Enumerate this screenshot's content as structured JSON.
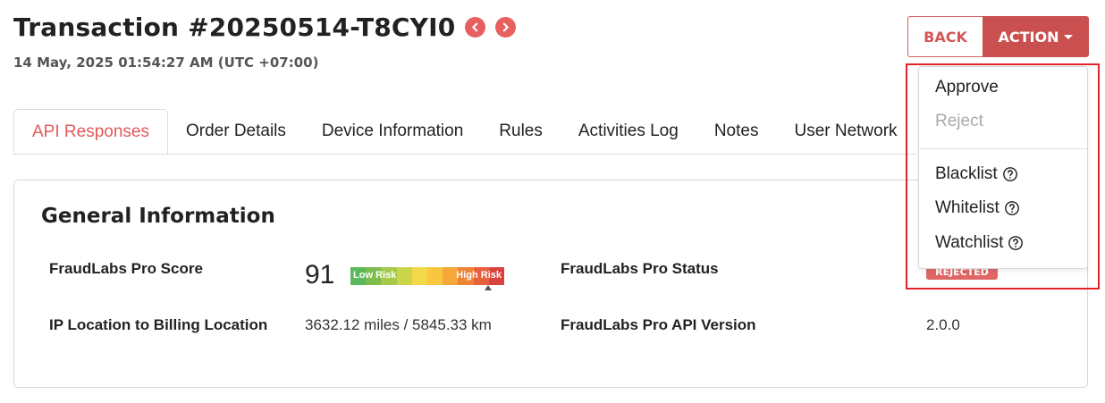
{
  "header": {
    "title": "Transaction #20250514-T8CYI0",
    "timestamp": "14 May, 2025 01:54:27 AM (UTC +07:00)",
    "prev_icon": "chevron-left-icon",
    "next_icon": "chevron-right-icon"
  },
  "toolbar": {
    "back_label": "BACK",
    "action_label": "ACTION"
  },
  "tabs": [
    {
      "label": "API Responses",
      "active": true
    },
    {
      "label": "Order Details",
      "active": false
    },
    {
      "label": "Device Information",
      "active": false
    },
    {
      "label": "Rules",
      "active": false
    },
    {
      "label": "Activities Log",
      "active": false
    },
    {
      "label": "Notes",
      "active": false
    },
    {
      "label": "User Network",
      "active": false
    }
  ],
  "general": {
    "title": "General Information",
    "score_label": "FraudLabs Pro Score",
    "score_value": "91",
    "risk_low_label": "Low Risk",
    "risk_high_label": "High Risk",
    "status_label": "FraudLabs Pro Status",
    "status_value": "REJECTED",
    "ip_label": "IP Location to Billing Location",
    "ip_value": "3632.12 miles / 5845.33 km",
    "api_version_label": "FraudLabs Pro API Version",
    "api_version_value": "2.0.0"
  },
  "action_menu": {
    "items": [
      {
        "label": "Approve",
        "disabled": false
      },
      {
        "label": "Reject",
        "disabled": true
      },
      {
        "label": "Blacklist",
        "help": true
      },
      {
        "label": "Whitelist",
        "help": true
      },
      {
        "label": "Watchlist",
        "help": true
      }
    ]
  },
  "colors": {
    "accent": "#c9504f",
    "tab_active": "#e05a5a",
    "highlight": "#e2232a",
    "risk_gradient": [
      "#5cb85c",
      "#8cc152",
      "#b5d334",
      "#d7d84a",
      "#f5d742",
      "#f9c840",
      "#f4a63a",
      "#ee7a3a",
      "#e55b3c",
      "#d9433f"
    ]
  }
}
